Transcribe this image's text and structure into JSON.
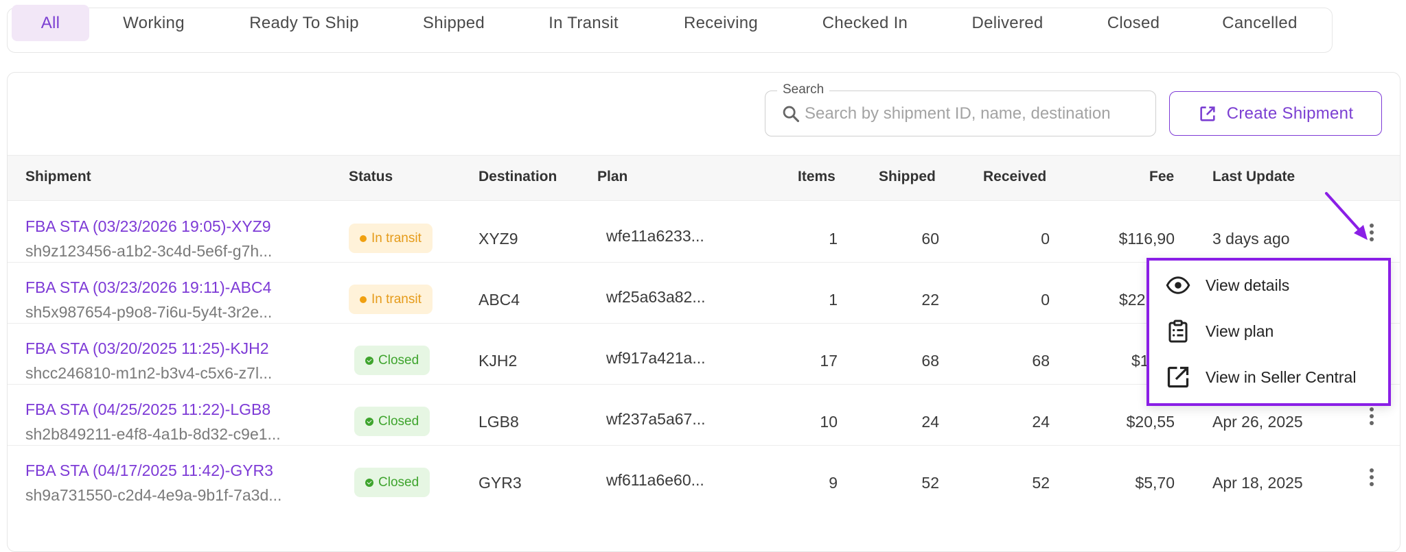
{
  "tabs": [
    {
      "label": "All",
      "active": true
    },
    {
      "label": "Working",
      "active": false
    },
    {
      "label": "Ready To Ship",
      "active": false
    },
    {
      "label": "Shipped",
      "active": false
    },
    {
      "label": "In Transit",
      "active": false
    },
    {
      "label": "Receiving",
      "active": false
    },
    {
      "label": "Checked In",
      "active": false
    },
    {
      "label": "Delivered",
      "active": false
    },
    {
      "label": "Closed",
      "active": false
    },
    {
      "label": "Cancelled",
      "active": false
    }
  ],
  "search": {
    "label": "Search",
    "placeholder": "Search by shipment ID, name, destination",
    "value": ""
  },
  "create_button": {
    "label": "Create Shipment",
    "icon": "external-link-icon"
  },
  "table": {
    "headers": {
      "shipment": "Shipment",
      "status": "Status",
      "destination": "Destination",
      "plan": "Plan",
      "items": "Items",
      "shipped": "Shipped",
      "received": "Received",
      "fee": "Fee",
      "last_update": "Last Update"
    },
    "rows": [
      {
        "name": "FBA STA (03/23/2026 19:05)-XYZ9",
        "id": "sh9z123456-a1b2-3c4d-5e6f-g7h...",
        "status": "In transit",
        "status_type": "transit",
        "destination": "XYZ9",
        "plan": "wfe11a6233...",
        "items": "1",
        "shipped": "60",
        "received": "0",
        "fee": "$116,90",
        "last_update": "3 days ago"
      },
      {
        "name": "FBA STA (03/23/2026 19:11)-ABC4",
        "id": "sh5x987654-p9o8-7i6u-5y4t-3r2e...",
        "status": "In transit",
        "status_type": "transit",
        "destination": "ABC4",
        "plan": "wf25a63a82...",
        "items": "1",
        "shipped": "22",
        "received": "0",
        "fee": "$22",
        "last_update": ""
      },
      {
        "name": "FBA STA (03/20/2025 11:25)-KJH2",
        "id": "shcc246810-m1n2-b3v4-c5x6-z7l...",
        "status": "Closed",
        "status_type": "closed",
        "destination": "KJH2",
        "plan": "wf917a421a...",
        "items": "17",
        "shipped": "68",
        "received": "68",
        "fee": "$1",
        "last_update": ""
      },
      {
        "name": "FBA STA (04/25/2025 11:22)-LGB8",
        "id": "sh2b849211-e4f8-4a1b-8d32-c9e1...",
        "status": "Closed",
        "status_type": "closed",
        "destination": "LGB8",
        "plan": "wf237a5a67...",
        "items": "10",
        "shipped": "24",
        "received": "24",
        "fee": "$20,55",
        "last_update": "Apr 26, 2025"
      },
      {
        "name": "FBA STA (04/17/2025 11:42)-GYR3",
        "id": "sh9a731550-c2d4-4e9a-9b1f-7a3d...",
        "status": "Closed",
        "status_type": "closed",
        "destination": "GYR3",
        "plan": "wf611a6e60...",
        "items": "9",
        "shipped": "52",
        "received": "52",
        "fee": "$5,70",
        "last_update": "Apr 18, 2025"
      }
    ]
  },
  "row_menu": {
    "items": [
      {
        "label": "View details",
        "icon": "eye-icon"
      },
      {
        "label": "View plan",
        "icon": "clipboard-list-icon"
      },
      {
        "label": "View in Seller Central",
        "icon": "external-link-icon"
      }
    ]
  },
  "colors": {
    "accent": "#7d3ad6",
    "active_tab_bg": "#f2e7f7",
    "menu_border": "#8a1fe6",
    "transit_bg": "#fff2d9",
    "transit_fg": "#e59b1a",
    "closed_bg": "#e6f6e3",
    "closed_fg": "#3ea42d"
  }
}
